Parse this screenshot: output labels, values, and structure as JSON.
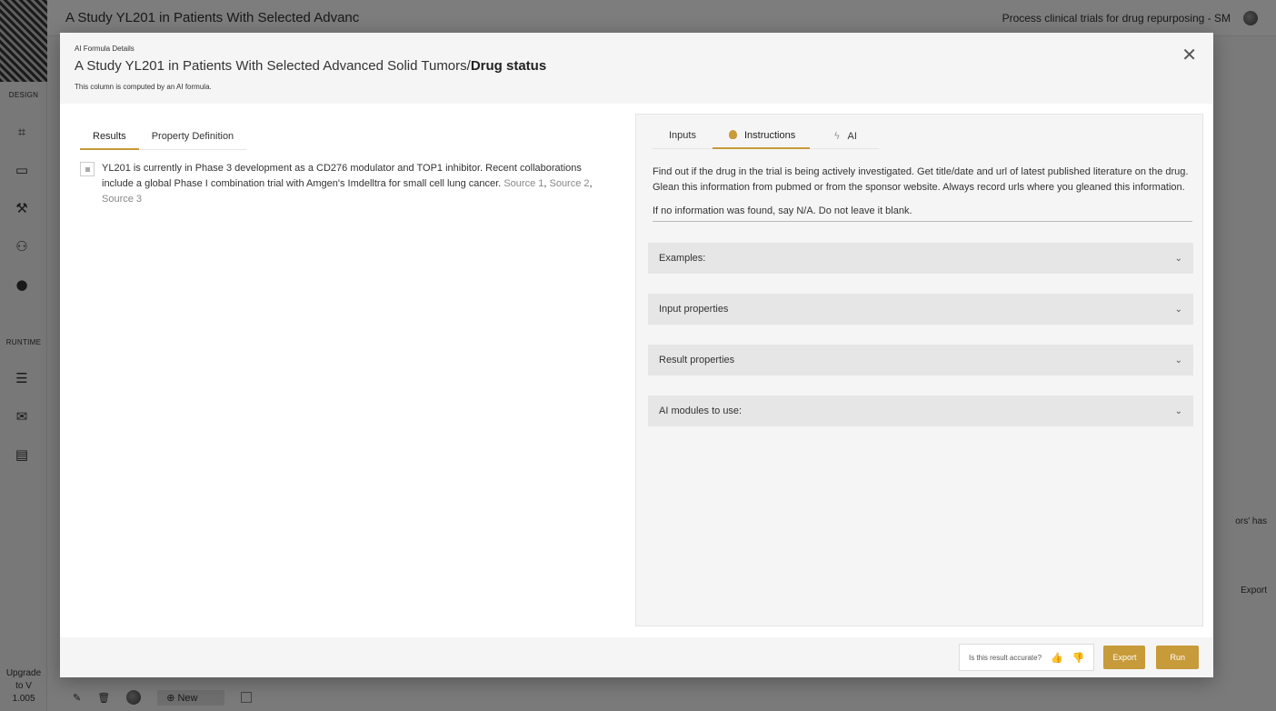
{
  "app": {
    "title": "A Study YL201 in Patients With Selected Advanc",
    "project": "Process clinical trials for drug repurposing - SM",
    "sidebar": {
      "design_label": "DESIGN",
      "runtime_label": "RUNTIME",
      "upgrade_line1": "Upgrade",
      "upgrade_line2": "to V",
      "upgrade_line3": "1.005"
    },
    "bottom": {
      "new_label": "New"
    },
    "bg_fragments": {
      "has": "ors' has",
      "export": "Export"
    }
  },
  "modal": {
    "kicker": "AI Formula Details",
    "heading_prefix": "A Study YL201 in Patients With Selected Advanced Solid Tumors/",
    "heading_bold": "Drug status",
    "subtitle": "This column is computed by an AI formula.",
    "left_tabs": {
      "results": "Results",
      "property_definition": "Property Definition"
    },
    "result": {
      "text": "YL201 is currently in Phase 3 development as a CD276 modulator and TOP1 inhibitor. Recent collaborations include a global Phase I combination trial with Amgen's Imdelltra for small cell lung cancer. ",
      "source1": "Source 1",
      "sep1": ", ",
      "source2": "Source 2",
      "sep2": ", ",
      "source3": "Source 3"
    },
    "right_tabs": {
      "inputs": "Inputs",
      "instructions": "Instructions",
      "ai": "AI"
    },
    "instructions": {
      "para1": "Find out if the drug in the trial is being actively investigated. Get title/date and url of latest published literature on the drug. Glean this information from pubmed or from the sponsor website. Always record urls where you gleaned this information.",
      "para2": "If no information was found, say N/A. Do not leave it blank."
    },
    "accordions": {
      "examples": "Examples:",
      "input_properties": "Input properties",
      "result_properties": "Result properties",
      "ai_modules": "AI modules to use:"
    },
    "footer": {
      "accuracy_question": "Is this result accurate?",
      "export": "Export",
      "run": "Run"
    }
  },
  "colors": {
    "accent": "#c79a3a",
    "panel": "#f5f5f5",
    "accordion": "#e6e6e6"
  },
  "icons": [
    "close-icon",
    "lightbulb-icon",
    "bolt-icon",
    "thumbs-up-icon",
    "thumbs-down-icon",
    "chevron-down-icon",
    "globe-icon"
  ]
}
